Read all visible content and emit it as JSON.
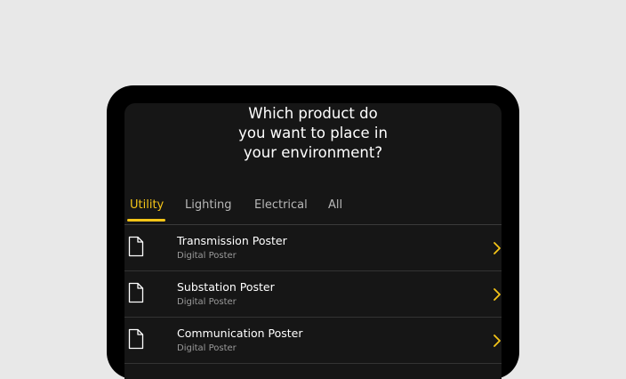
{
  "prompt": {
    "line1": "Which product do",
    "line2": "you want to place in",
    "line3": "your environment?"
  },
  "tabs": [
    {
      "label": "Utility",
      "active": true
    },
    {
      "label": "Lighting",
      "active": false
    },
    {
      "label": "Electrical",
      "active": false
    },
    {
      "label": "All",
      "active": false
    }
  ],
  "products": [
    {
      "title": "Transmission Poster",
      "subtitle": "Digital Poster",
      "icon": "document-icon"
    },
    {
      "title": "Substation Poster",
      "subtitle": "Digital Poster",
      "icon": "document-icon"
    },
    {
      "title": "Communication Poster",
      "subtitle": "Digital Poster",
      "icon": "document-icon"
    }
  ],
  "colors": {
    "accent": "#f5c518",
    "background": "#161616",
    "device": "#000000",
    "page": "#e8e8e8"
  }
}
